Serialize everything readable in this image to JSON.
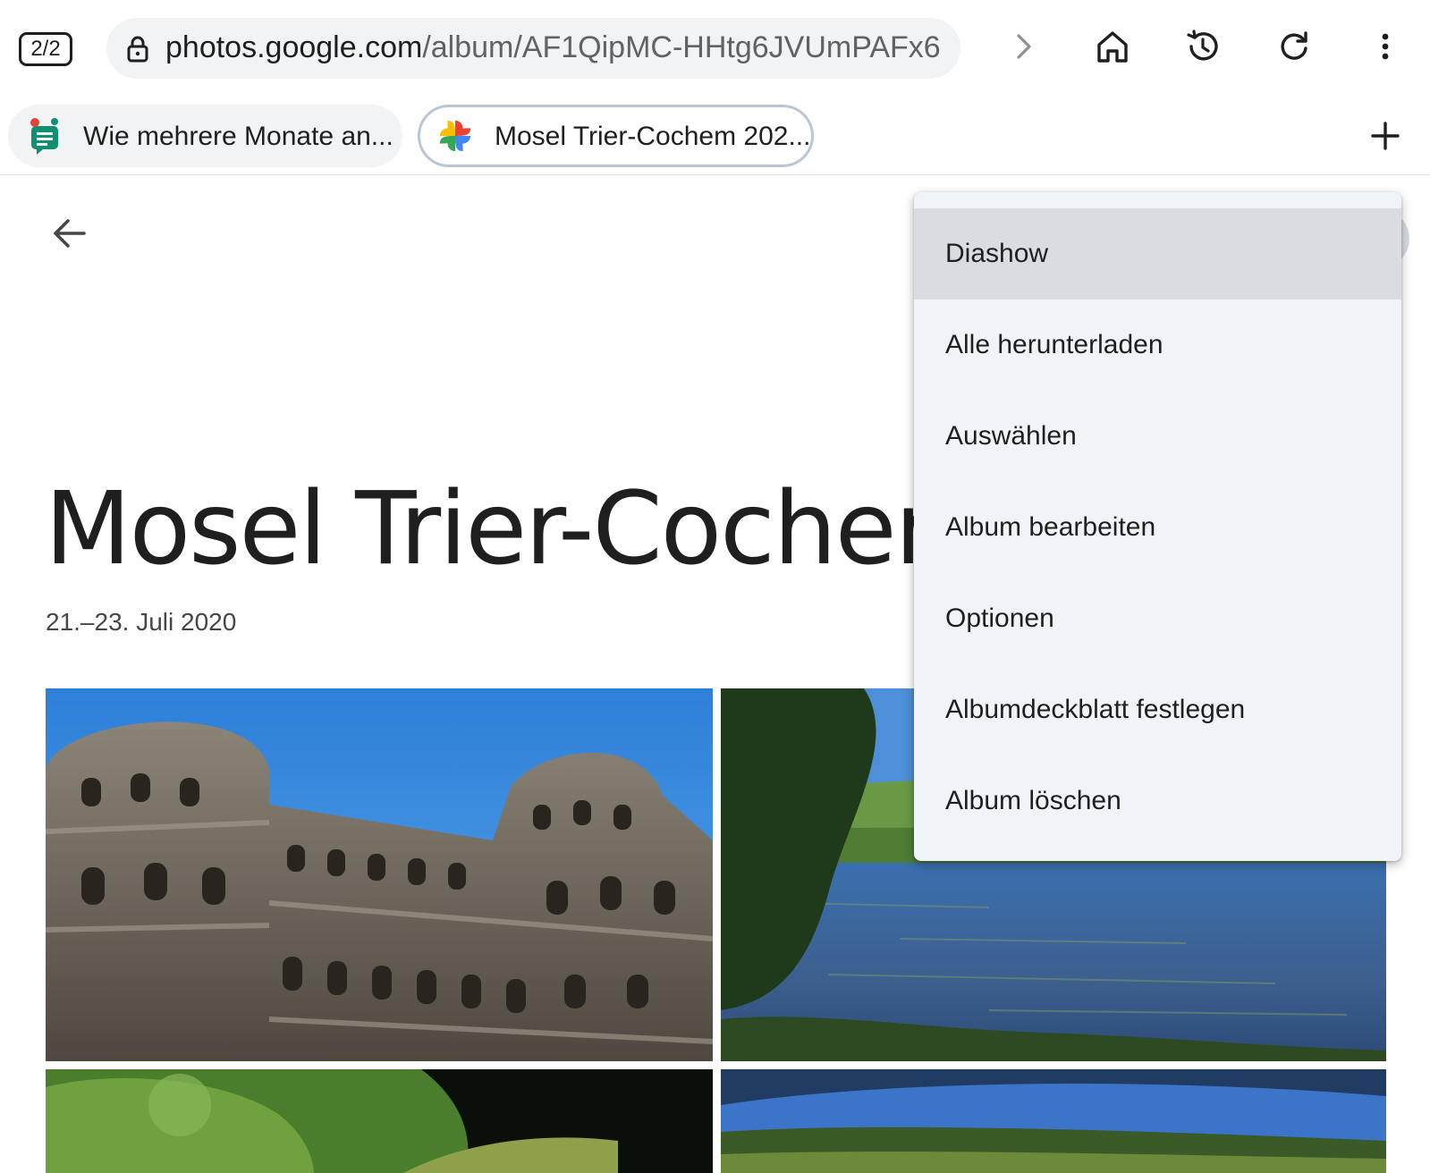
{
  "browser": {
    "tab_count": "2/2",
    "url_host": "photos.google.com",
    "url_path": "/album/AF1QipMC-HHtg6JVUmPAFx6"
  },
  "tabs": [
    {
      "title": "Wie mehrere Monate an...",
      "active": false,
      "favicon": "android-chat-favicon"
    },
    {
      "title": "Mosel Trier-Cochem 202...",
      "active": true,
      "favicon": "google-photos-pinwheel-favicon"
    }
  ],
  "album": {
    "title": "Mosel Trier-Cochem",
    "date": "21.–23. Juli 2020"
  },
  "menu": {
    "items": [
      "Diashow",
      "Alle herunterladen",
      "Auswählen",
      "Album bearbeiten",
      "Optionen",
      "Albumdeckblatt festlegen",
      "Album löschen"
    ],
    "highlighted": "Diashow"
  },
  "icons": [
    "lock-icon",
    "forward-icon",
    "home-icon",
    "history-icon",
    "reload-icon",
    "more-vert-icon",
    "new-tab-icon",
    "back-arrow-icon"
  ],
  "photos": [
    {
      "subject": "porta-nigra"
    },
    {
      "subject": "mosel-river"
    },
    {
      "subject": "trees-vineyard"
    },
    {
      "subject": "vineyard-hills"
    }
  ],
  "colors": {
    "menu_bg": "#f0f4f9",
    "menu_highlight": "#d9dce0",
    "omnibox_bg": "#f1f3f4"
  }
}
